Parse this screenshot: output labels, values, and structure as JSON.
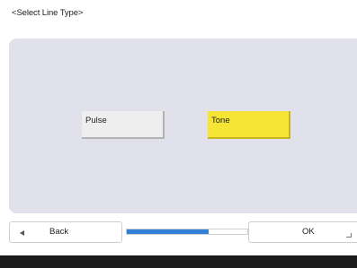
{
  "screen": {
    "title": "<Select Line Type>"
  },
  "options": {
    "pulse_label": "Pulse",
    "tone_label": "Tone",
    "selected": "Tone"
  },
  "bottom_bar": {
    "back_label": "Back",
    "ok_label": "OK",
    "progress_fraction": 0.68
  },
  "colors": {
    "panel_background": "#e0e1ea",
    "selected_option": "#f6e534",
    "unselected_option": "#eeeeee",
    "progress_fill": "#2f80d6",
    "footer": "#1b1b1b"
  },
  "icons": {
    "back": "left-triangle-arrow",
    "ok": "enter-return-arrow"
  }
}
